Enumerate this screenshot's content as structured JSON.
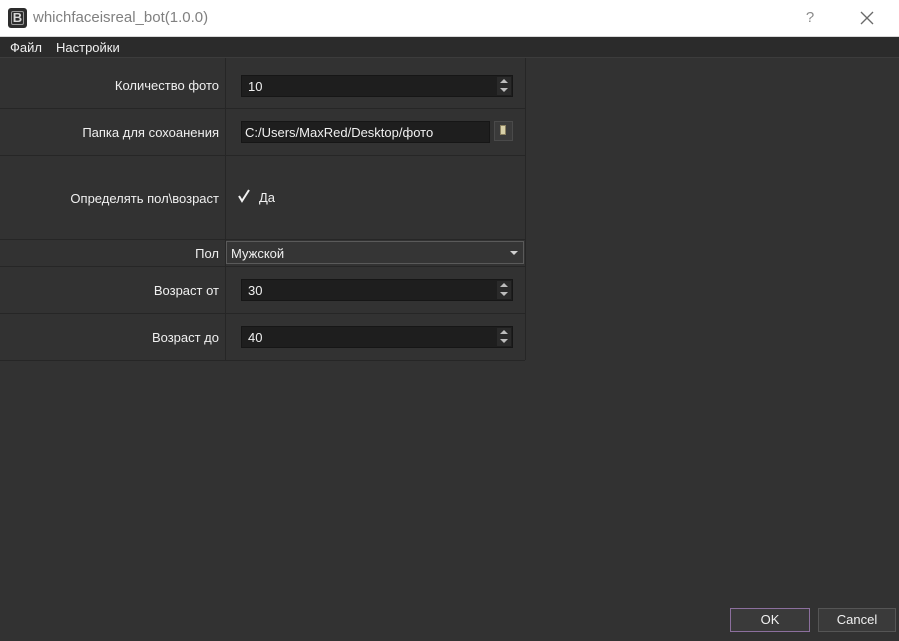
{
  "window": {
    "icon_letter": "B",
    "title": "whichfaceisreal_bot(1.0.0)",
    "help_label": "?"
  },
  "menu": {
    "items": [
      {
        "label": "Файл"
      },
      {
        "label": "Настройки"
      }
    ]
  },
  "form": {
    "photo_count": {
      "label": "Количество фото",
      "value": "10"
    },
    "save_folder": {
      "label": "Папка для сохоанения",
      "value": "C:/Users/MaxRed/Desktop/фото"
    },
    "detect": {
      "label": "Определять пол\\возраст",
      "checkbox_label": "Да",
      "checked": true
    },
    "gender": {
      "label": "Пол",
      "value": "Мужской"
    },
    "age_from": {
      "label": "Возраст от",
      "value": "30"
    },
    "age_to": {
      "label": "Возраст до",
      "value": "40"
    }
  },
  "buttons": {
    "ok": "OK",
    "cancel": "Cancel"
  },
  "colors": {
    "background": "#323232",
    "field_background": "#1e1e1e",
    "ok_border": "#8c6f9e"
  }
}
